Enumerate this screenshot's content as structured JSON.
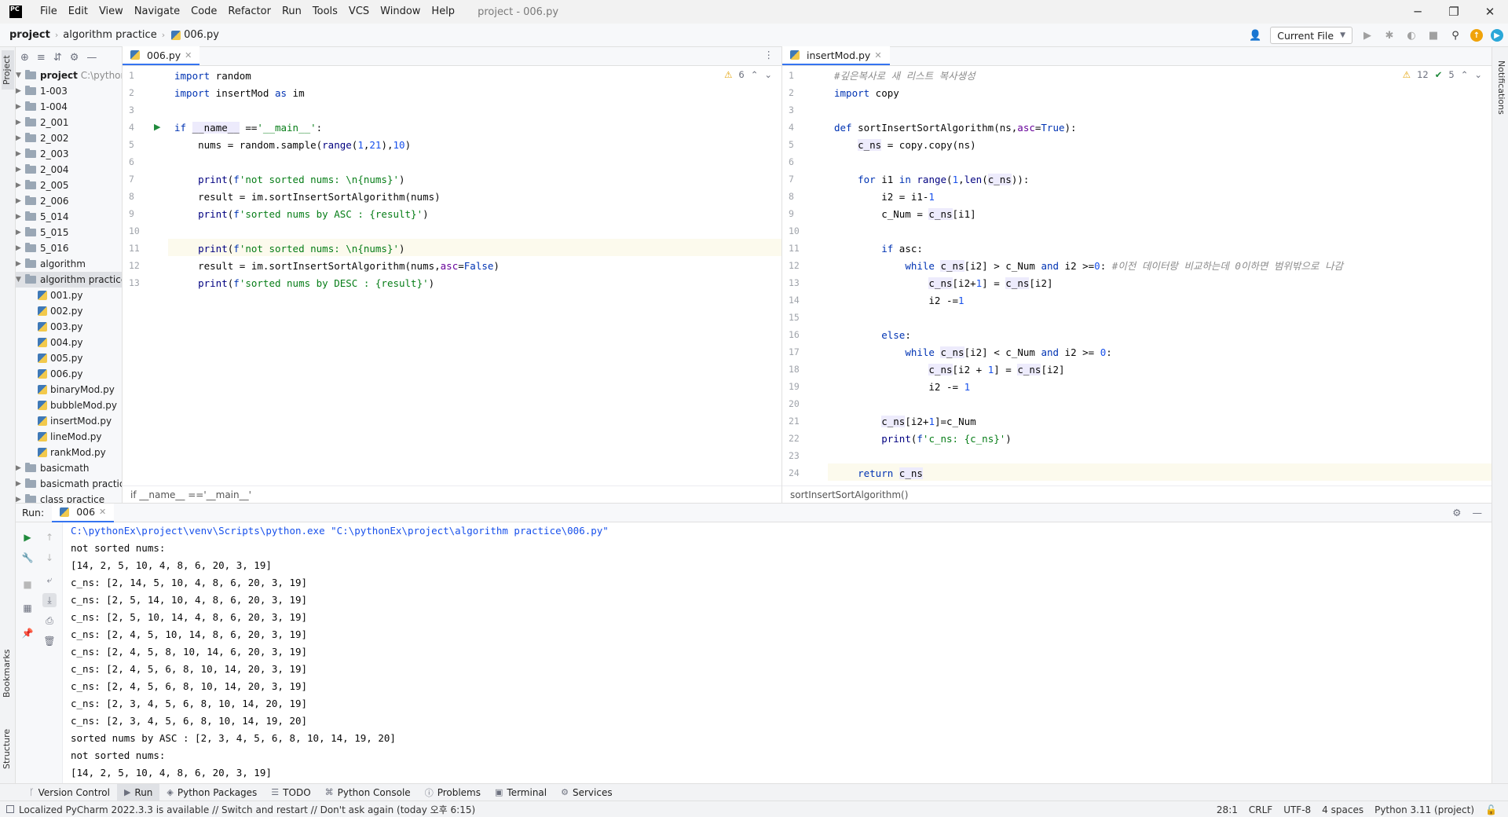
{
  "titlebar": {
    "logo": "PC",
    "menu": [
      "File",
      "Edit",
      "View",
      "Navigate",
      "Code",
      "Refactor",
      "Run",
      "Tools",
      "VCS",
      "Window",
      "Help"
    ],
    "window_title": "project - 006.py",
    "controls": [
      "─",
      "❐",
      "✕"
    ]
  },
  "navbar": {
    "crumbs": [
      "project",
      "algorithm practice",
      "006.py"
    ],
    "run_config": "Current File"
  },
  "left_stripe": {
    "project": "Project",
    "bookmarks": "Bookmarks",
    "structure": "Structure"
  },
  "right_stripe": {
    "notifications": "Notifications"
  },
  "project_panel": {
    "root": {
      "label": "project",
      "path": "C:\\pythonEx"
    },
    "folders": [
      "1-003",
      "1-004",
      "2_001",
      "2_002",
      "2_003",
      "2_004",
      "2_005",
      "2_006",
      "5_014",
      "5_015",
      "5_016",
      "algorithm"
    ],
    "open_folder": "algorithm practice",
    "files": [
      "001.py",
      "002.py",
      "003.py",
      "004.py",
      "005.py",
      "006.py",
      "binaryMod.py",
      "bubbleMod.py",
      "insertMod.py",
      "lineMod.py",
      "rankMod.py"
    ],
    "after_folders": [
      "basicmath",
      "basicmath practice",
      "class practice"
    ]
  },
  "left_editor": {
    "tab": "006.py",
    "inspection": {
      "warnings": "6"
    },
    "line_numbers": [
      "1",
      "2",
      "3",
      "4",
      "5",
      "6",
      "7",
      "8",
      "9",
      "10",
      "11",
      "12",
      "13"
    ],
    "lines": [
      "import random",
      "import insertMod as im",
      "",
      "if __name__ =='__main__':",
      "    nums = random.sample(range(1,21),10)",
      "",
      "    print(f'not sorted nums: \\n{nums}')",
      "    result = im.sortInsertSortAlgorithm(nums)",
      "    print(f'sorted nums by ASC : {result}')",
      "",
      "    print(f'not sorted nums: \\n{nums}')",
      "    result = im.sortInsertSortAlgorithm(nums,asc=False)",
      "    print(f'sorted nums by DESC : {result}')"
    ],
    "breadcrumb": "if __name__ =='__main__'"
  },
  "right_editor": {
    "tab": "insertMod.py",
    "inspection": {
      "warnings": "12",
      "ok": "5"
    },
    "line_numbers": [
      "1",
      "2",
      "3",
      "4",
      "5",
      "6",
      "7",
      "8",
      "9",
      "10",
      "11",
      "12",
      "13",
      "14",
      "15",
      "16",
      "17",
      "18",
      "19",
      "20",
      "21",
      "22",
      "23",
      "24"
    ],
    "lines": [
      "#깊은복사로 새 리스트 복사생성",
      "import copy",
      "",
      "def sortInsertSortAlgorithm(ns,asc=True):",
      "    c_ns = copy.copy(ns)",
      "",
      "    for i1 in range(1,len(c_ns)):",
      "        i2 = i1-1",
      "        c_Num = c_ns[i1]",
      "",
      "        if asc:",
      "            while c_ns[i2] > c_Num and i2 >=0: #이전 데이터랑 비교하는데 0이하면 범위밖으로 나감",
      "                c_ns[i2+1] = c_ns[i2]",
      "                i2 -=1",
      "",
      "        else:",
      "            while c_ns[i2] < c_Num and i2 >= 0:",
      "                c_ns[i2 + 1] = c_ns[i2]",
      "                i2 -= 1",
      "",
      "        c_ns[i2+1]=c_Num",
      "        print(f'c_ns: {c_ns}')",
      "",
      "    return c_ns"
    ],
    "breadcrumb": "sortInsertSortAlgorithm()"
  },
  "run_panel": {
    "label": "Run:",
    "tab": "006",
    "output": [
      "C:\\pythonEx\\project\\venv\\Scripts\\python.exe \"C:\\pythonEx\\project\\algorithm practice\\006.py\"",
      "not sorted nums:",
      "[14, 2, 5, 10, 4, 8, 6, 20, 3, 19]",
      "c_ns: [2, 14, 5, 10, 4, 8, 6, 20, 3, 19]",
      "c_ns: [2, 5, 14, 10, 4, 8, 6, 20, 3, 19]",
      "c_ns: [2, 5, 10, 14, 4, 8, 6, 20, 3, 19]",
      "c_ns: [2, 4, 5, 10, 14, 8, 6, 20, 3, 19]",
      "c_ns: [2, 4, 5, 8, 10, 14, 6, 20, 3, 19]",
      "c_ns: [2, 4, 5, 6, 8, 10, 14, 20, 3, 19]",
      "c_ns: [2, 4, 5, 6, 8, 10, 14, 20, 3, 19]",
      "c_ns: [2, 3, 4, 5, 6, 8, 10, 14, 20, 19]",
      "c_ns: [2, 3, 4, 5, 6, 8, 10, 14, 19, 20]",
      "sorted nums by ASC : [2, 3, 4, 5, 6, 8, 10, 14, 19, 20]",
      "not sorted nums:",
      "[14, 2, 5, 10, 4, 8, 6, 20, 3, 19]"
    ]
  },
  "bottom_tabs": [
    "Version Control",
    "Run",
    "Python Packages",
    "TODO",
    "Python Console",
    "Problems",
    "Terminal",
    "Services"
  ],
  "status": {
    "message": "Localized PyCharm 2022.3.3 is available // Switch and restart // Don't ask again (today 오후 6:15)",
    "position": "28:1",
    "line_sep": "CRLF",
    "encoding": "UTF-8",
    "indent": "4 spaces",
    "interpreter": "Python 3.11 (project)"
  },
  "colors": {
    "keyword": "#0033b3",
    "string": "#067d17",
    "number": "#1750eb",
    "comment": "#8c8c8c",
    "accent": "#3574f0"
  }
}
